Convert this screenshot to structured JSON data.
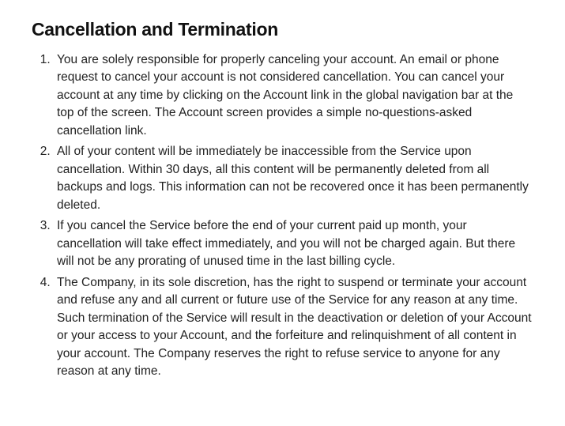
{
  "heading": "Cancellation and Termination",
  "items": [
    "You are solely responsible for properly canceling your account. An email or phone request to cancel your account is not considered cancellation. You can cancel your account at any time by clicking on the Account link in the global navigation bar at the top of the screen. The Account screen provides a simple no-questions-asked cancellation link.",
    "All of your content will be immediately be inaccessible from the Service upon cancellation. Within 30 days, all this content will be permanently deleted from all backups and logs. This information can not be recovered once it has been permanently deleted.",
    "If you cancel the Service before the end of your current paid up month, your cancellation will take effect immediately, and you will not be charged again. But there will not be any prorating of unused time in the last billing cycle.",
    "The Company, in its sole discretion, has the right to suspend or terminate your account and refuse any and all current or future use of the Service for any reason at any time. Such termination of the Service will result in the deactivation or deletion of your Account or your access to your Account, and the forfeiture and relinquishment of all content in your account. The Company reserves the right to refuse service to anyone for any reason at any time."
  ]
}
